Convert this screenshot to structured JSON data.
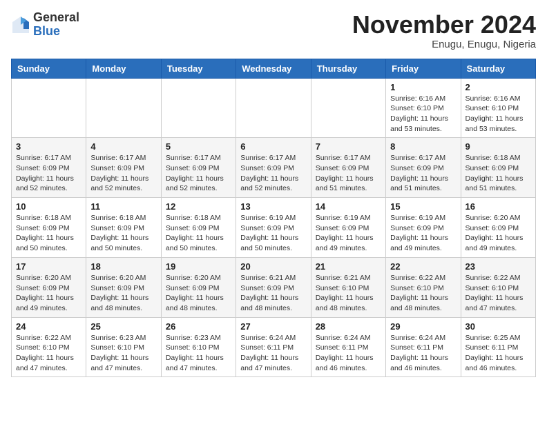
{
  "header": {
    "logo_line1": "General",
    "logo_line2": "Blue",
    "month_title": "November 2024",
    "location": "Enugu, Enugu, Nigeria"
  },
  "days_of_week": [
    "Sunday",
    "Monday",
    "Tuesday",
    "Wednesday",
    "Thursday",
    "Friday",
    "Saturday"
  ],
  "weeks": [
    [
      {
        "day": "",
        "info": ""
      },
      {
        "day": "",
        "info": ""
      },
      {
        "day": "",
        "info": ""
      },
      {
        "day": "",
        "info": ""
      },
      {
        "day": "",
        "info": ""
      },
      {
        "day": "1",
        "info": "Sunrise: 6:16 AM\nSunset: 6:10 PM\nDaylight: 11 hours\nand 53 minutes."
      },
      {
        "day": "2",
        "info": "Sunrise: 6:16 AM\nSunset: 6:10 PM\nDaylight: 11 hours\nand 53 minutes."
      }
    ],
    [
      {
        "day": "3",
        "info": "Sunrise: 6:17 AM\nSunset: 6:09 PM\nDaylight: 11 hours\nand 52 minutes."
      },
      {
        "day": "4",
        "info": "Sunrise: 6:17 AM\nSunset: 6:09 PM\nDaylight: 11 hours\nand 52 minutes."
      },
      {
        "day": "5",
        "info": "Sunrise: 6:17 AM\nSunset: 6:09 PM\nDaylight: 11 hours\nand 52 minutes."
      },
      {
        "day": "6",
        "info": "Sunrise: 6:17 AM\nSunset: 6:09 PM\nDaylight: 11 hours\nand 52 minutes."
      },
      {
        "day": "7",
        "info": "Sunrise: 6:17 AM\nSunset: 6:09 PM\nDaylight: 11 hours\nand 51 minutes."
      },
      {
        "day": "8",
        "info": "Sunrise: 6:17 AM\nSunset: 6:09 PM\nDaylight: 11 hours\nand 51 minutes."
      },
      {
        "day": "9",
        "info": "Sunrise: 6:18 AM\nSunset: 6:09 PM\nDaylight: 11 hours\nand 51 minutes."
      }
    ],
    [
      {
        "day": "10",
        "info": "Sunrise: 6:18 AM\nSunset: 6:09 PM\nDaylight: 11 hours\nand 50 minutes."
      },
      {
        "day": "11",
        "info": "Sunrise: 6:18 AM\nSunset: 6:09 PM\nDaylight: 11 hours\nand 50 minutes."
      },
      {
        "day": "12",
        "info": "Sunrise: 6:18 AM\nSunset: 6:09 PM\nDaylight: 11 hours\nand 50 minutes."
      },
      {
        "day": "13",
        "info": "Sunrise: 6:19 AM\nSunset: 6:09 PM\nDaylight: 11 hours\nand 50 minutes."
      },
      {
        "day": "14",
        "info": "Sunrise: 6:19 AM\nSunset: 6:09 PM\nDaylight: 11 hours\nand 49 minutes."
      },
      {
        "day": "15",
        "info": "Sunrise: 6:19 AM\nSunset: 6:09 PM\nDaylight: 11 hours\nand 49 minutes."
      },
      {
        "day": "16",
        "info": "Sunrise: 6:20 AM\nSunset: 6:09 PM\nDaylight: 11 hours\nand 49 minutes."
      }
    ],
    [
      {
        "day": "17",
        "info": "Sunrise: 6:20 AM\nSunset: 6:09 PM\nDaylight: 11 hours\nand 49 minutes."
      },
      {
        "day": "18",
        "info": "Sunrise: 6:20 AM\nSunset: 6:09 PM\nDaylight: 11 hours\nand 48 minutes."
      },
      {
        "day": "19",
        "info": "Sunrise: 6:20 AM\nSunset: 6:09 PM\nDaylight: 11 hours\nand 48 minutes."
      },
      {
        "day": "20",
        "info": "Sunrise: 6:21 AM\nSunset: 6:09 PM\nDaylight: 11 hours\nand 48 minutes."
      },
      {
        "day": "21",
        "info": "Sunrise: 6:21 AM\nSunset: 6:10 PM\nDaylight: 11 hours\nand 48 minutes."
      },
      {
        "day": "22",
        "info": "Sunrise: 6:22 AM\nSunset: 6:10 PM\nDaylight: 11 hours\nand 48 minutes."
      },
      {
        "day": "23",
        "info": "Sunrise: 6:22 AM\nSunset: 6:10 PM\nDaylight: 11 hours\nand 47 minutes."
      }
    ],
    [
      {
        "day": "24",
        "info": "Sunrise: 6:22 AM\nSunset: 6:10 PM\nDaylight: 11 hours\nand 47 minutes."
      },
      {
        "day": "25",
        "info": "Sunrise: 6:23 AM\nSunset: 6:10 PM\nDaylight: 11 hours\nand 47 minutes."
      },
      {
        "day": "26",
        "info": "Sunrise: 6:23 AM\nSunset: 6:10 PM\nDaylight: 11 hours\nand 47 minutes."
      },
      {
        "day": "27",
        "info": "Sunrise: 6:24 AM\nSunset: 6:11 PM\nDaylight: 11 hours\nand 47 minutes."
      },
      {
        "day": "28",
        "info": "Sunrise: 6:24 AM\nSunset: 6:11 PM\nDaylight: 11 hours\nand 46 minutes."
      },
      {
        "day": "29",
        "info": "Sunrise: 6:24 AM\nSunset: 6:11 PM\nDaylight: 11 hours\nand 46 minutes."
      },
      {
        "day": "30",
        "info": "Sunrise: 6:25 AM\nSunset: 6:11 PM\nDaylight: 11 hours\nand 46 minutes."
      }
    ]
  ]
}
